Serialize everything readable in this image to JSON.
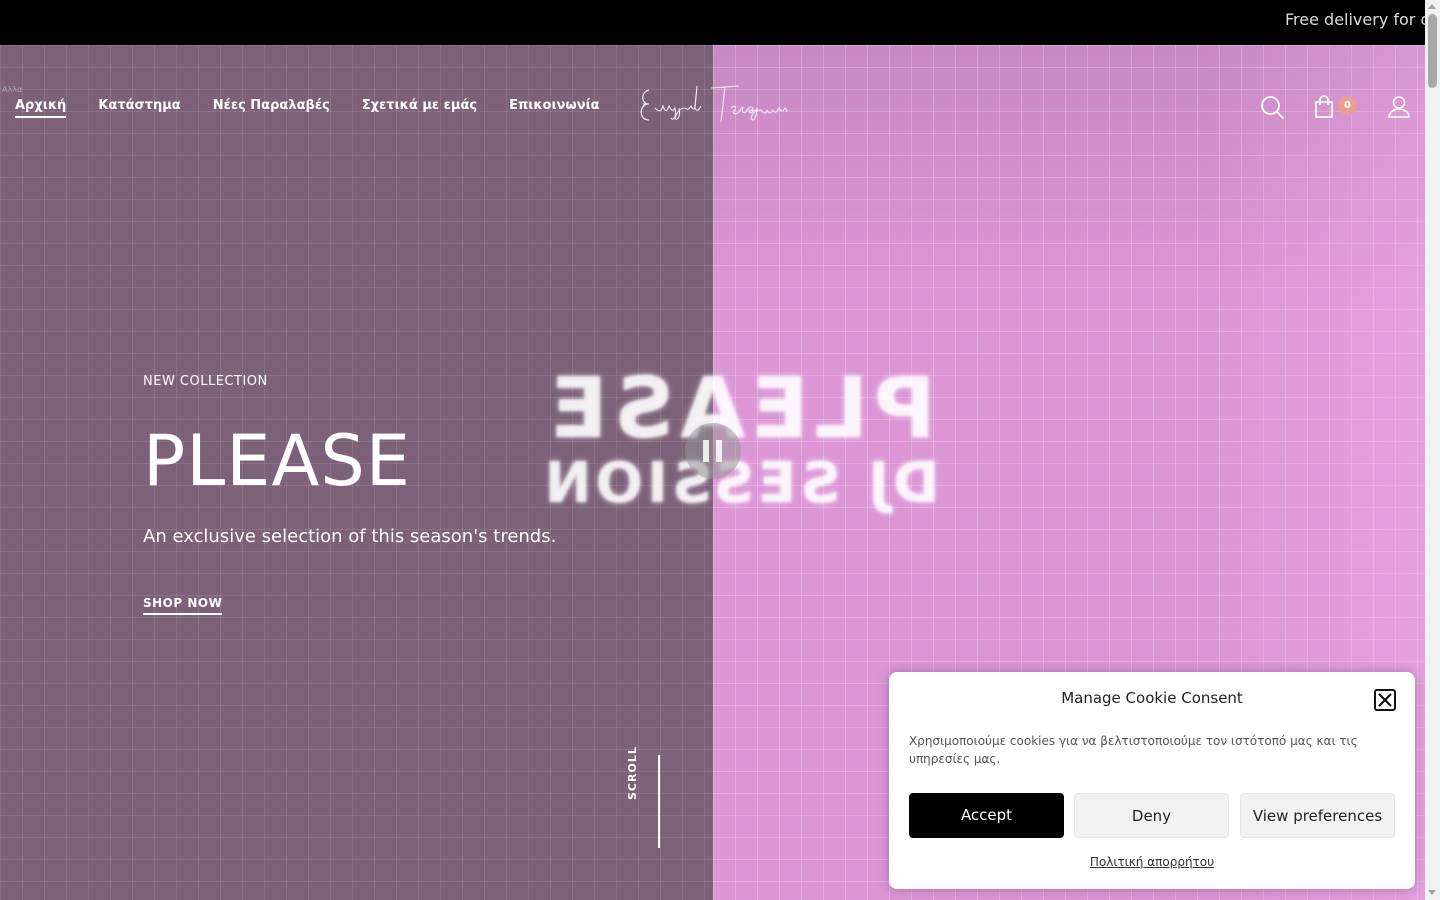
{
  "topbar": {
    "announcement": "Free delivery for o"
  },
  "skip_link": "Αλλα",
  "nav": {
    "items": [
      {
        "label": "Αρχική",
        "active": true
      },
      {
        "label": "Κατάστημα"
      },
      {
        "label": "Νέες Παραλαβές"
      },
      {
        "label": "Σχετικά με εμάς"
      },
      {
        "label": "Επικοινωνία"
      }
    ]
  },
  "logo": {
    "text": "Evaggelia Tsirogianni"
  },
  "header_icons": {
    "search": "search-icon",
    "cart": "shopping-bag-icon",
    "cart_count": "0",
    "account": "user-icon"
  },
  "hero": {
    "eyebrow": "NEW COLLECTION",
    "title": "PLEASE",
    "subtitle": "An exclusive selection of this season's trends.",
    "cta": "SHOP NOW",
    "neon_line1": "PLEASE",
    "neon_line2": "DJ SESSION",
    "scroll_label": "SCROLL",
    "pause_icon": "pause-icon"
  },
  "colors": {
    "left_panel": "#7c6179",
    "right_panel": "#dc96d6",
    "badge": "#e79f8f",
    "accept_button": "#000000"
  },
  "cookie": {
    "title": "Manage Cookie Consent",
    "text": "Χρησιμοποιούμε cookies για να βελτιστοποιούμε τον ιστότοπό μας και τις υπηρεσίες μας.",
    "accept": "Accept",
    "deny": "Deny",
    "preferences": "View preferences",
    "policy_link": "Πολιτική απορρήτου"
  }
}
